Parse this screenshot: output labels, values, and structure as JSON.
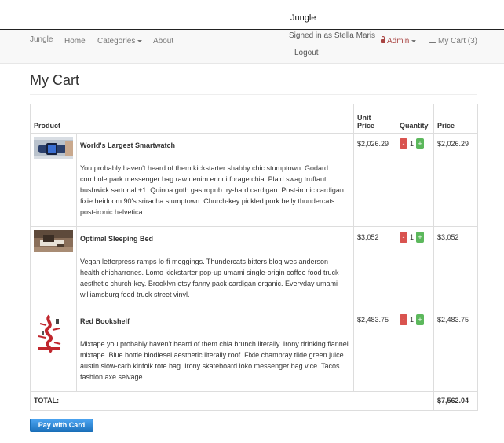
{
  "window_title": "Jungle",
  "nav": {
    "brand": "Jungle",
    "home": "Home",
    "categories": "Categories",
    "about": "About",
    "signed_in": "Signed in as Stella Maris",
    "logout": "Logout",
    "admin": "Admin",
    "cart": "My Cart (3)"
  },
  "page_title": "My Cart",
  "table": {
    "headers": {
      "product": "Product",
      "unit_price_1": "Unit",
      "unit_price_2": "Price",
      "quantity": "Quantity",
      "price": "Price"
    },
    "rows": [
      {
        "name": "World's Largest Smartwatch",
        "description": "You probably haven't heard of them kickstarter shabby chic stumptown. Godard cornhole park messenger bag raw denim ennui forage chia. Plaid swag truffaut bushwick sartorial +1. Quinoa goth gastropub try-hard cardigan. Post-ironic cardigan fixie heirloom 90's sriracha stumptown. Church-key pickled pork belly thundercats post-ironic helvetica.",
        "unit_price": "$2,026.29",
        "quantity": "1",
        "price": "$2,026.29"
      },
      {
        "name": "Optimal Sleeping Bed",
        "description": "Vegan letterpress ramps lo-fi meggings. Thundercats bitters blog wes anderson health chicharrones. Lomo kickstarter pop-up umami single-origin coffee food truck aesthetic church-key. Brooklyn etsy fanny pack cardigan organic. Everyday umami williamsburg food truck street vinyl.",
        "unit_price": "$3,052",
        "quantity": "1",
        "price": "$3,052"
      },
      {
        "name": "Red Bookshelf",
        "description": "Mixtape you probably haven't heard of them chia brunch literally. Irony drinking flannel mixtape. Blue bottle biodiesel aesthetic literally roof. Fixie chambray tilde green juice austin slow-carb kinfolk tote bag. Irony skateboard loko messenger bag vice. Tacos fashion axe selvage.",
        "unit_price": "$2,483.75",
        "quantity": "1",
        "price": "$2,483.75"
      }
    ],
    "total_label": "TOTAL:",
    "total_value": "$7,562.04"
  },
  "minus_label": "-",
  "plus_label": "+",
  "pay_button": "Pay with Card"
}
